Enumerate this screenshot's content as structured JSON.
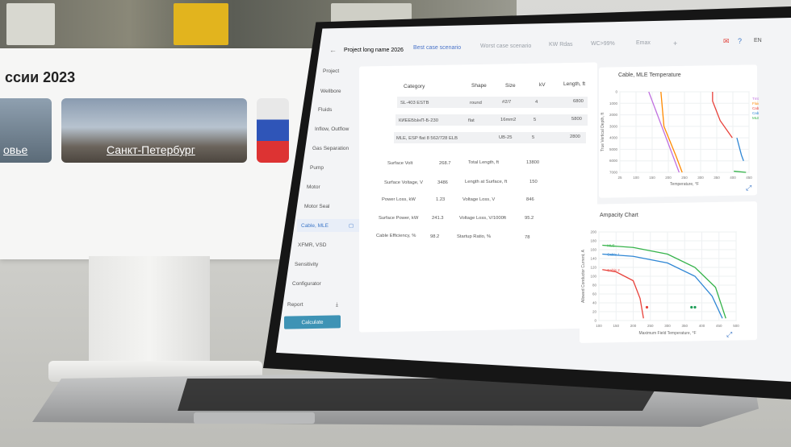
{
  "monitor": {
    "title": "ссии 2023",
    "tiles": [
      {
        "caption": "овье"
      },
      {
        "caption": "Санкт-Петербург"
      },
      {
        "caption": ""
      }
    ]
  },
  "app": {
    "back_icon": "arrow-left-icon",
    "tabs": [
      {
        "label": "Project long name 2026",
        "state": "normal"
      },
      {
        "label": "Best case scenario",
        "state": "active"
      },
      {
        "label": "Worst case scenario",
        "state": "muted"
      },
      {
        "label": "KW Rdas",
        "state": "muted"
      },
      {
        "label": "WC>99%",
        "state": "muted"
      },
      {
        "label": "Emax",
        "state": "muted"
      },
      {
        "label": "+",
        "state": "muted"
      }
    ],
    "lang": "EN",
    "nav": [
      {
        "label": "Project"
      },
      {
        "label": "Wellbore"
      },
      {
        "label": "Fluids"
      },
      {
        "label": "Inflow, Outflow"
      },
      {
        "label": "Gas Separation"
      },
      {
        "label": "Pump"
      },
      {
        "label": "Motor"
      },
      {
        "label": "Motor Seal"
      },
      {
        "label": "Cable, MLE"
      },
      {
        "label": "XFMR, VSD"
      },
      {
        "label": "Sensitivity"
      },
      {
        "label": "Configurator"
      }
    ],
    "report_label": "Report",
    "calculate_label": "Calculate",
    "table": {
      "headers": [
        "Category",
        "Shape",
        "Size",
        "kV",
        "Length, ft"
      ],
      "rows": [
        [
          "SL-403 ESTB",
          "round",
          "#2/7",
          "4",
          "6800"
        ],
        [
          "КИЕЕБЫнП-Б-230",
          "flat",
          "16mm2",
          "5",
          "5800"
        ],
        [
          "MLE, ESP flat 8 562/728 ELB",
          "",
          "UB-25",
          "5",
          "2800"
        ]
      ]
    },
    "results": [
      {
        "label": "Surface Volt",
        "value": "268.7",
        "label2": "Total Length, ft",
        "value2": "13800"
      },
      {
        "label": "Surface Voltage, V",
        "value": "3486",
        "label2": "Length at Surface, ft",
        "value2": "150"
      },
      {
        "label": "Power Loss, kW",
        "value": "1.23",
        "label2": "Voltage Loss, V",
        "value2": "846"
      },
      {
        "label": "Surface Power, kW",
        "value": "241.3",
        "label2": "Voltage Loss, V/1000ft",
        "value2": "95.2"
      },
      {
        "label": "Cable Efficiency, %",
        "value": "98.2",
        "label2": "Startup Ratio, %",
        "value2": "78"
      }
    ],
    "chart1_title": "Cable, MLE Temperature",
    "chart2_title": "Ampacity Chart"
  },
  "chart_data": [
    {
      "type": "line",
      "title": "Cable, MLE Temperature",
      "xlabel": "Temperature, °F",
      "ylabel": "True Vertical Depth, ft",
      "x_ticks": [
        "25",
        "100",
        "150",
        "200",
        "250",
        "300",
        "350",
        "400",
        "450"
      ],
      "y_ticks": [
        "0",
        "1000",
        "2000",
        "3000",
        "4000",
        "5000",
        "6000",
        "7000"
      ],
      "legend": [
        "Tmt",
        "Fluid",
        "Cable 1",
        "Cable 2",
        "MLE"
      ],
      "colors": {
        "Tmt": "#c070e0",
        "Fluid": "#ff8a00",
        "Cable 1": "#e8413a",
        "Cable 2": "#2e86d4",
        "MLE": "#35b34a"
      },
      "series": [
        {
          "name": "Tmt",
          "x": [
            120,
            220
          ],
          "y": [
            0,
            7000
          ]
        },
        {
          "name": "Fluid",
          "x": [
            160,
            170,
            210,
            230
          ],
          "y": [
            0,
            3000,
            5600,
            7000
          ]
        },
        {
          "name": "Cable 1",
          "x": [
            330,
            330,
            355,
            395
          ],
          "y": [
            0,
            800,
            2500,
            4000
          ]
        },
        {
          "name": "Cable 2",
          "x": [
            410,
            425,
            432
          ],
          "y": [
            4000,
            5500,
            6000
          ]
        },
        {
          "name": "MLE",
          "x": [
            400,
            440
          ],
          "y": [
            6900,
            7000
          ]
        }
      ]
    },
    {
      "type": "line",
      "title": "Ampacity Chart",
      "xlabel": "Maximum Field Temperature, °F",
      "ylabel": "Allowed Conductor Current, A",
      "x_ticks": [
        "100",
        "150",
        "200",
        "250",
        "300",
        "350",
        "400",
        "450",
        "500"
      ],
      "y_ticks": [
        "0",
        "20",
        "40",
        "60",
        "80",
        "100",
        "120",
        "140",
        "160",
        "180",
        "200"
      ],
      "series": [
        {
          "name": "MLE",
          "color": "#35b34a",
          "x": [
            110,
            200,
            300,
            380,
            440,
            470
          ],
          "y": [
            170,
            165,
            150,
            120,
            75,
            5
          ]
        },
        {
          "name": "Cable 1",
          "color": "#2e86d4",
          "x": [
            110,
            200,
            300,
            380,
            430,
            460
          ],
          "y": [
            150,
            145,
            130,
            100,
            55,
            5
          ]
        },
        {
          "name": "Cable 2",
          "color": "#e8413a",
          "x": [
            110,
            150,
            200,
            220,
            230
          ],
          "y": [
            115,
            110,
            90,
            50,
            5
          ]
        }
      ],
      "points": [
        {
          "x": 240,
          "y": 30,
          "color": "#e8413a"
        },
        {
          "x": 370,
          "y": 30,
          "color": "#1e9e58"
        },
        {
          "x": 380,
          "y": 30,
          "color": "#1e9e58"
        }
      ]
    }
  ]
}
